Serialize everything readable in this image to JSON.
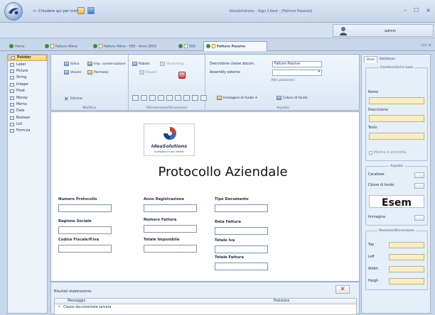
{
  "titlebar": {
    "back_link": "<- Chiudere qui per iniziare",
    "title": "IdeaSolutions - Sign Client - [Fatture Passive]",
    "controls": {
      "minimize": "–",
      "maximize": "☐",
      "close": "×"
    }
  },
  "user": {
    "name": "admin"
  },
  "tabs": [
    {
      "label": "Home"
    },
    {
      "label": "Fatture Attive"
    },
    {
      "label": "Fatture Attive - SSS - Anno 2003"
    },
    {
      "label": "SSS"
    },
    {
      "label": "Fatture Passive"
    }
  ],
  "tab_controls": "◁ ▷ ×",
  "toolbox": {
    "items": [
      "Pointer",
      "Label",
      "Picture",
      "String",
      "Integer",
      "Float",
      "Money",
      "Memo",
      "Date",
      "Boolean",
      "List",
      "Formula"
    ],
    "selected": "Pointer"
  },
  "ribbon": {
    "salva": "Salva",
    "imp_conservazione": "Imp. conservazione",
    "robots": "Robots",
    "versioning": "Versioning",
    "volumi": "Volumi",
    "permessi": "Permessi",
    "report": "Report",
    "elimina": "Elimina",
    "group_modifica": "Modifica",
    "group_allineamento": "Allineamento/Dimensioni",
    "desc_label": "Descrizione classe docum.",
    "desc_value": "Fatture Passive",
    "assembly_label": "Assembly esterno",
    "assembly_value": "",
    "group_altri": "Altri parametri",
    "immagine_sfondo": "Immagine di fondo",
    "colore_sfondo": "Colore di fondo",
    "group_aspetto": "Aspetto"
  },
  "canvas": {
    "logo_name": "IdeaSolutions",
    "logo_tag": "Software to get better",
    "title": "Protocollo Aziendale",
    "fields": {
      "numero_protocollo": "Numero Protocollo",
      "anno_registrazione": "Anno Registrazione",
      "tipo_documento": "Tipo Documento",
      "ragione_sociale": "Ragione Sociale",
      "numero_fattura": "Numero Fattura",
      "data_fattura": "Data Fattura",
      "codice_fiscale": "Codice Fiscale/P.Iva",
      "totale_imponibile": "Totale Imponibile",
      "totale_iva": "Totale Iva",
      "totale_fattura": "Totale Fattura"
    }
  },
  "results": {
    "label": "Risultati elaborazione:",
    "close": "✕",
    "columns": [
      "Messaggio",
      "Posizione"
    ],
    "rows": [
      {
        "message": "Classe documentale salvata",
        "position": ""
      }
    ]
  },
  "right_panel": {
    "tabs": [
      "Base",
      "Database"
    ],
    "section_base": "Caratteristiche base",
    "nome": "Nome",
    "descrizione": "Descrizione",
    "testo": "Testo",
    "mostra_etichetta": "Mostra in etichetta",
    "section_aspetto": "Aspetto",
    "carattere": "Carattere",
    "colore_fondo": "Colore di fondo",
    "esempio": "Esem",
    "immagine": "Immagine",
    "section_posizione": "Posizione/Dimensione",
    "top": "Top",
    "left": "Left",
    "width": "Width",
    "height": "Heigh"
  },
  "colors": {
    "accent": "#ffcf63",
    "chrome": "#c7d7eb",
    "close_red": "#d62b1d"
  },
  "icons": [
    "orb-logo-icon",
    "user-icon",
    "home-icon",
    "document-icon",
    "save-icon",
    "delete-icon",
    "close-icon",
    "ideasolutions-logo"
  ]
}
